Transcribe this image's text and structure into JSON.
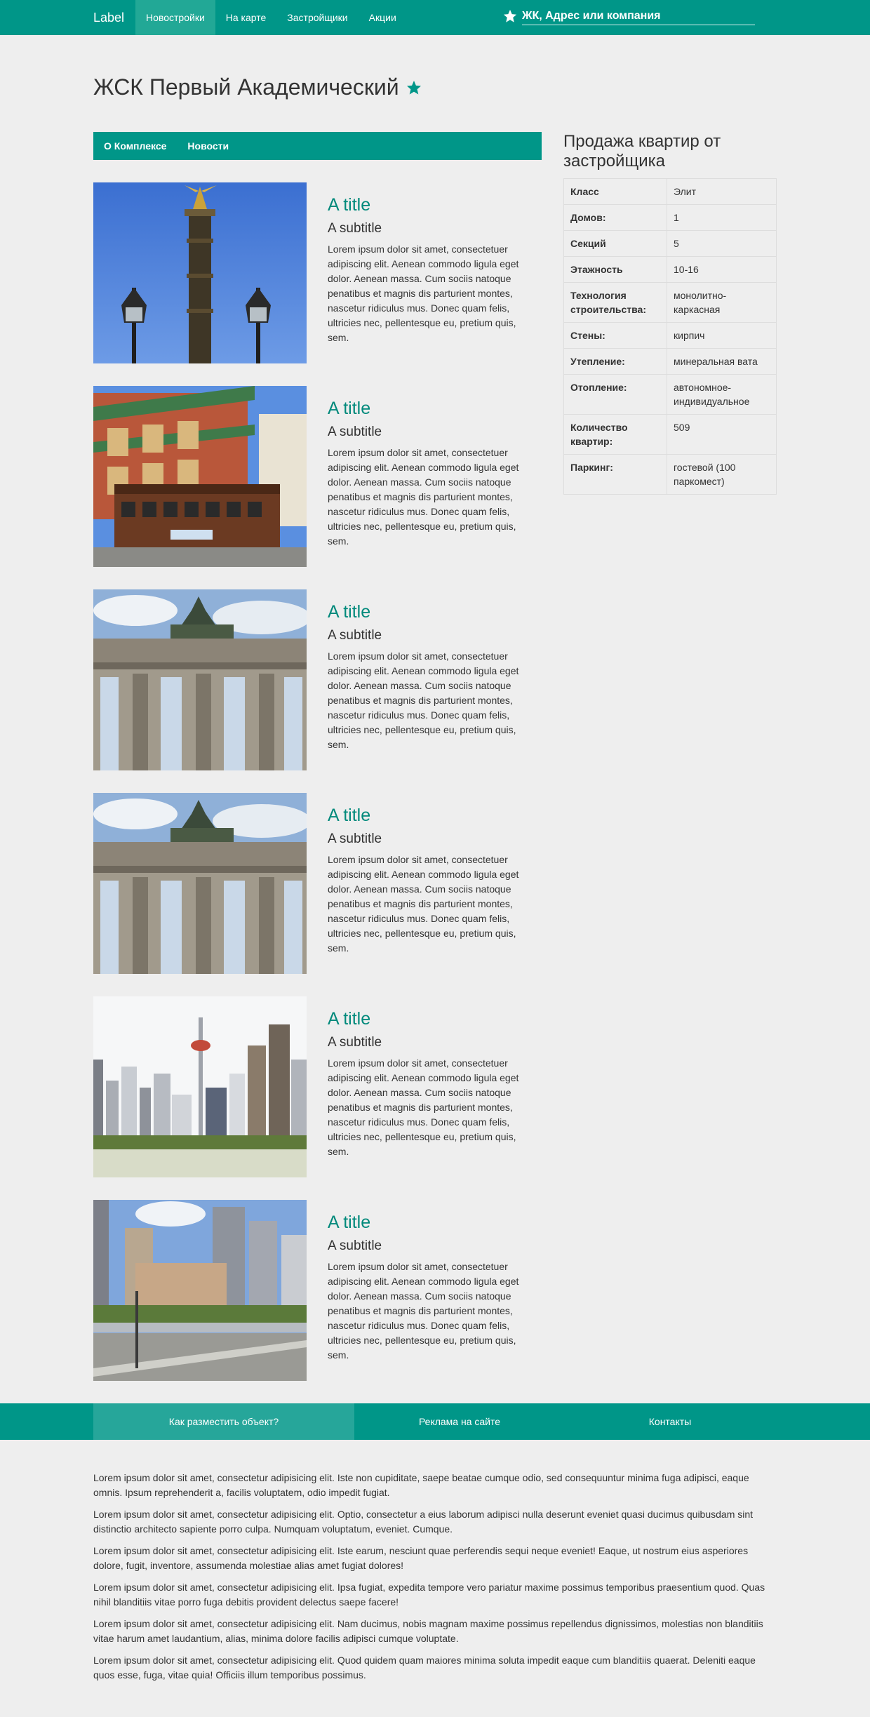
{
  "navbar": {
    "brand": "Label",
    "items": [
      {
        "label": "Новостройки",
        "active": true
      },
      {
        "label": "На карте",
        "active": false
      },
      {
        "label": "Застройщики",
        "active": false
      },
      {
        "label": "Акции",
        "active": false
      }
    ],
    "search_placeholder": "ЖК, Адрес или компания",
    "search_icon": "star-icon"
  },
  "page": {
    "title": "ЖСК Первый Академический",
    "title_icon": "star-icon"
  },
  "tabs": [
    {
      "label": "О Комплексе"
    },
    {
      "label": "Новости"
    }
  ],
  "news": [
    {
      "image": "victory-column-photo",
      "title": "A title",
      "subtitle": "A subtitle",
      "text": "Lorem ipsum dolor sit amet, consectetuer adipiscing elit. Aenean commodo ligula eget dolor. Aenean massa. Cum sociis natoque penatibus et magnis dis parturient montes, nascetur ridiculus mus. Donec quam felis, ultricies nec, pellentesque eu, pretium quis, sem."
    },
    {
      "image": "chinatown-cable-car-photo",
      "title": "A title",
      "subtitle": "A subtitle",
      "text": "Lorem ipsum dolor sit amet, consectetuer adipiscing elit. Aenean commodo ligula eget dolor. Aenean massa. Cum sociis natoque penatibus et magnis dis parturient montes, nascetur ridiculus mus. Donec quam felis, ultricies nec, pellentesque eu, pretium quis, sem."
    },
    {
      "image": "brandenburg-gate-photo",
      "title": "A title",
      "subtitle": "A subtitle",
      "text": "Lorem ipsum dolor sit amet, consectetuer adipiscing elit. Aenean commodo ligula eget dolor. Aenean massa. Cum sociis natoque penatibus et magnis dis parturient montes, nascetur ridiculus mus. Donec quam felis, ultricies nec, pellentesque eu, pretium quis, sem."
    },
    {
      "image": "brandenburg-gate-photo",
      "title": "A title",
      "subtitle": "A subtitle",
      "text": "Lorem ipsum dolor sit amet, consectetuer adipiscing elit. Aenean commodo ligula eget dolor. Aenean massa. Cum sociis natoque penatibus et magnis dis parturient montes, nascetur ridiculus mus. Donec quam felis, ultricies nec, pellentesque eu, pretium quis, sem."
    },
    {
      "image": "city-skyline-photo",
      "title": "A title",
      "subtitle": "A subtitle",
      "text": "Lorem ipsum dolor sit amet, consectetuer adipiscing elit. Aenean commodo ligula eget dolor. Aenean massa. Cum sociis natoque penatibus et magnis dis parturient montes, nascetur ridiculus mus. Donec quam felis, ultricies nec, pellentesque eu, pretium quis, sem."
    },
    {
      "image": "city-street-photo",
      "title": "A title",
      "subtitle": "A subtitle",
      "text": "Lorem ipsum dolor sit amet, consectetuer adipiscing elit. Aenean commodo ligula eget dolor. Aenean massa. Cum sociis natoque penatibus et magnis dis parturient montes, nascetur ridiculus mus. Donec quam felis, ultricies nec, pellentesque eu, pretium quis, sem."
    }
  ],
  "sidebar": {
    "heading": "Продажа квартир от застройщика",
    "properties": [
      {
        "key": "Класс",
        "value": "Элит"
      },
      {
        "key": "Домов:",
        "value": "1"
      },
      {
        "key": "Секций",
        "value": "5"
      },
      {
        "key": "Этажность",
        "value": "10-16"
      },
      {
        "key": "Технология строительства:",
        "value": "монолитно-каркасная"
      },
      {
        "key": "Стены:",
        "value": "кирпич"
      },
      {
        "key": "Утепление:",
        "value": "минеральная вата"
      },
      {
        "key": "Отопление:",
        "value": "автономное-индивидуальное"
      },
      {
        "key": "Количество квартир:",
        "value": "509"
      },
      {
        "key": "Паркинг:",
        "value": "гостевой (100 паркомест)"
      }
    ]
  },
  "footer_nav": [
    {
      "label": "Как разместить объект?",
      "active": true
    },
    {
      "label": "Реклама на сайте",
      "active": false
    },
    {
      "label": "Контакты",
      "active": false
    }
  ],
  "footer_paragraphs": [
    "Lorem ipsum dolor sit amet, consectetur adipisicing elit. Iste non cupiditate, saepe beatae cumque odio, sed consequuntur minima fuga adipisci, eaque omnis. Ipsum reprehenderit a, facilis voluptatem, odio impedit fugiat.",
    "Lorem ipsum dolor sit amet, consectetur adipisicing elit. Optio, consectetur a eius laborum adipisci nulla deserunt eveniet quasi ducimus quibusdam sint distinctio architecto sapiente porro culpa. Numquam voluptatum, eveniet. Cumque.",
    "Lorem ipsum dolor sit amet, consectetur adipisicing elit. Iste earum, nesciunt quae perferendis sequi neque eveniet! Eaque, ut nostrum eius asperiores dolore, fugit, inventore, assumenda molestiae alias amet fugiat dolores!",
    "Lorem ipsum dolor sit amet, consectetur adipisicing elit. Ipsa fugiat, expedita tempore vero pariatur maxime possimus temporibus praesentium quod. Quas nihil blanditiis vitae porro fuga debitis provident delectus saepe facere!",
    "Lorem ipsum dolor sit amet, consectetur adipisicing elit. Nam ducimus, nobis magnam maxime possimus repellendus dignissimos, molestias non blanditiis vitae harum amet laudantium, alias, minima dolore facilis adipisci cumque voluptate.",
    "Lorem ipsum dolor sit amet, consectetur adipisicing elit. Quod quidem quam maiores minima soluta impedit eaque cum blanditiis quaerat. Deleniti eaque quos esse, fuga, vitae quia! Officiis illum temporibus possimus."
  ],
  "colors": {
    "primary": "#009688",
    "primary_light": "#26a69a",
    "accent_text": "#00897b",
    "background": "#eeeeee"
  }
}
